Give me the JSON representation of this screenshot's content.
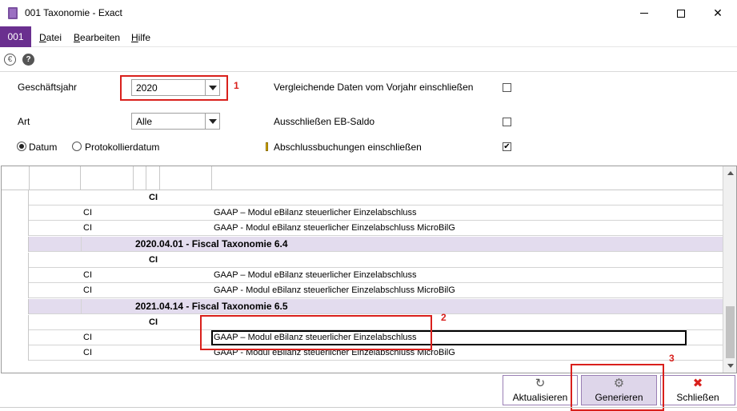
{
  "window": {
    "title": "001 Taxonomie - Exact",
    "minimize_glyph": "",
    "close_glyph": "✕"
  },
  "menubar": {
    "company": "001",
    "items": [
      {
        "label": "Datei",
        "accel": "D",
        "rest": "atei"
      },
      {
        "label": "Bearbeiten",
        "accel": "B",
        "rest": "earbeiten"
      },
      {
        "label": "Hilfe",
        "accel": "H",
        "rest": "ilfe"
      }
    ]
  },
  "iconbar": {
    "euro_glyph": "€",
    "help_glyph": "?"
  },
  "form": {
    "year_label": "Geschäftsjahr",
    "year_value": "2020",
    "art_label": "Art",
    "art_value": "Alle",
    "compare_label": "Vergleichende Daten vom Vorjahr einschließen",
    "compare_checked": false,
    "exclude_label": "Ausschließen EB-Saldo",
    "exclude_checked": false,
    "closing_label": "Abschlussbuchungen einschließen",
    "closing_checked": true,
    "check_glyph": "✔",
    "radio_datum": "Datum",
    "radio_protokoll": "Protokollierdatum",
    "selected_radio": "Datum"
  },
  "annotations": {
    "one": "1",
    "two": "2",
    "three": "3",
    "color": "#d9201c"
  },
  "grid": {
    "rows": [
      {
        "type": "sub",
        "ci": "CI"
      },
      {
        "type": "item",
        "code": "CI",
        "desc": "GAAP – Modul eBilanz steuerlicher Einzelabschluss"
      },
      {
        "type": "item",
        "code": "CI",
        "desc": "GAAP - Modul eBilanz steuerlicher Einzelabschluss MicroBilG"
      },
      {
        "type": "group",
        "label": "2020.04.01 - Fiscal Taxonomie 6.4"
      },
      {
        "type": "sub",
        "ci": "CI"
      },
      {
        "type": "item",
        "code": "CI",
        "desc": "GAAP – Modul eBilanz steuerlicher Einzelabschluss"
      },
      {
        "type": "item",
        "code": "CI",
        "desc": "GAAP - Modul eBilanz steuerlicher Einzelabschluss MicroBilG"
      },
      {
        "type": "group",
        "label": "2021.04.14 - Fiscal Taxonomie 6.5"
      },
      {
        "type": "sub",
        "ci": "CI"
      },
      {
        "type": "item",
        "code": "CI",
        "desc": "GAAP – Modul eBilanz steuerlicher Einzelabschluss",
        "selected": true
      },
      {
        "type": "item",
        "code": "CI",
        "desc": "GAAP - Modul eBilanz steuerlicher Einzelabschluss MicroBilG"
      }
    ]
  },
  "buttons": {
    "refresh": {
      "label": "Aktualisieren",
      "accel": "k",
      "icon": "↻"
    },
    "generate": {
      "label": "Generieren",
      "accel": "G",
      "icon": "⚙"
    },
    "close": {
      "label": "Schließen",
      "accel": "c",
      "icon": "✖"
    }
  }
}
